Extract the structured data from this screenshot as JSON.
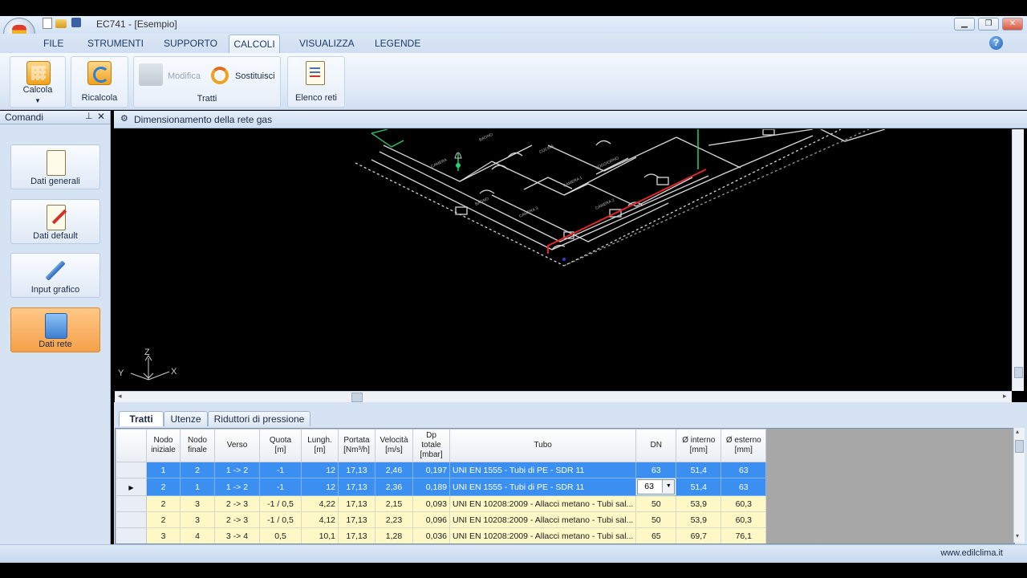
{
  "window": {
    "title": "EC741 - [Esempio]"
  },
  "menu": {
    "tabs": [
      "FILE",
      "STRUMENTI",
      "SUPPORTO",
      "CALCOLI",
      "VISUALIZZA",
      "LEGENDE"
    ],
    "active": "CALCOLI"
  },
  "ribbon": {
    "calcola": "Calcola",
    "ricalcola": "Ricalcola",
    "modifica": "Modifica",
    "sostituisci": "Sostituisci",
    "tratti_group": "Tratti",
    "elenco_reti": "Elenco reti"
  },
  "left_panel": {
    "title": "Comandi",
    "items": [
      "Dati generali",
      "Dati default",
      "Input grafico",
      "Dati rete"
    ],
    "active": "Dati rete"
  },
  "drawing": {
    "title": "Dimensionamento della rete gas",
    "axes": {
      "z": "Z",
      "y": "Y",
      "x": "X"
    }
  },
  "grid_tabs": [
    "Tratti",
    "Utenze",
    "Riduttori di pressione"
  ],
  "grid_active_tab": "Tratti",
  "table": {
    "headers": [
      [
        "Nodo",
        "iniziale"
      ],
      [
        "Nodo",
        "finale"
      ],
      [
        "Verso"
      ],
      [
        "Quota",
        "[m]"
      ],
      [
        "Lungh.",
        "[m]"
      ],
      [
        "Portata",
        "[Nm³/h]"
      ],
      [
        "Velocità",
        "[m/s]"
      ],
      [
        "Dp",
        "totale",
        "[mbar]"
      ],
      [
        "Tubo"
      ],
      [
        "DN"
      ],
      [
        "Ø interno",
        "[mm]"
      ],
      [
        "Ø esterno",
        "[mm]"
      ]
    ],
    "rows": [
      [
        "1",
        "2",
        "1 -> 2",
        "-1",
        "12",
        "17,13",
        "2,46",
        "0,197",
        "UNI EN 1555 - Tubi di PE - SDR 11",
        "63",
        "51,4",
        "63"
      ],
      [
        "2",
        "1",
        "1 -> 2",
        "-1",
        "12",
        "17,13",
        "2,36",
        "0,189",
        "UNI EN 1555 - Tubi di PE - SDR 11",
        "63",
        "51,4",
        "63"
      ],
      [
        "2",
        "3",
        "2 -> 3",
        "-1 / 0,5",
        "4,22",
        "17,13",
        "2,15",
        "0,093",
        "UNI EN 10208:2009 - Allacci metano - Tubi sal...",
        "50",
        "53,9",
        "60,3"
      ],
      [
        "2",
        "3",
        "2 -> 3",
        "-1 / 0,5",
        "4,12",
        "17,13",
        "2,23",
        "0,096",
        "UNI EN 10208:2009 - Allacci metano - Tubi sal...",
        "50",
        "53,9",
        "60,3"
      ],
      [
        "3",
        "4",
        "3 -> 4",
        "0,5",
        "10,1",
        "17,13",
        "1,28",
        "0,036",
        "UNI EN 10208:2009 - Allacci metano - Tubi sal...",
        "65",
        "69,7",
        "76,1"
      ]
    ],
    "selected_rows": [
      0,
      1
    ],
    "current_row": 1
  },
  "status": {
    "website": "www.edilclima.it"
  }
}
